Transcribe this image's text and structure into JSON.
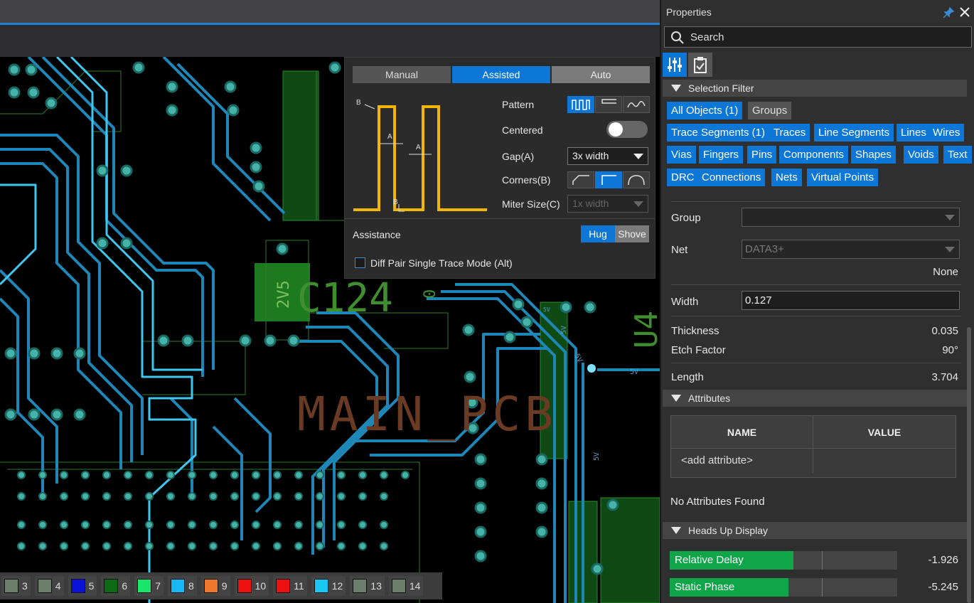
{
  "layers": [
    {
      "num": "3",
      "color": "#6b7f6b"
    },
    {
      "num": "4",
      "color": "#6b7f6b"
    },
    {
      "num": "5",
      "color": "#0a14d8"
    },
    {
      "num": "6",
      "color": "#0c6a12"
    },
    {
      "num": "7",
      "color": "#19e66a"
    },
    {
      "num": "8",
      "color": "#18b8f2"
    },
    {
      "num": "9",
      "color": "#f0782a"
    },
    {
      "num": "10",
      "color": "#ee1111"
    },
    {
      "num": "11",
      "color": "#ee1111"
    },
    {
      "num": "12",
      "color": "#18c8f2"
    },
    {
      "num": "13",
      "color": "#6b7f6b"
    },
    {
      "num": "14",
      "color": "#6b7f6b"
    }
  ],
  "canvas": {
    "labels": [
      "2V5",
      "C124",
      "0",
      "MAIN_PCB",
      "U4",
      "5V",
      "5V",
      "5V",
      "5V",
      "5V"
    ]
  },
  "assist": {
    "modes": [
      "Manual",
      "Assisted",
      "Auto"
    ],
    "active_mode": "Assisted",
    "pattern_label": "Pattern",
    "centered_label": "Centered",
    "centered_on": false,
    "gap_label": "Gap(A)",
    "gap_value": "3x width",
    "corners_label": "Corners(B)",
    "miter_label": "Miter Size(C)",
    "miter_value": "1x width",
    "diagram_labels": {
      "a1": "A",
      "a2": "A",
      "b1": "B",
      "b2": "B"
    },
    "assistance_label": "Assistance",
    "hug_label": "Hug",
    "shove_label": "Shove",
    "diff_pair_label": "Diff Pair Single Trace Mode (Alt)",
    "diff_pair_checked": false
  },
  "properties": {
    "title": "Properties",
    "search_placeholder": "Search",
    "selection_filter_title": "Selection Filter",
    "filters": [
      {
        "label": "All Objects (1)",
        "active": true
      },
      {
        "label": "Groups",
        "active": false
      },
      {
        "label": "Trace Segments (1)",
        "active": true
      },
      {
        "label": "Traces",
        "active": true
      },
      {
        "label": "Line Segments",
        "active": true
      },
      {
        "label": "Lines",
        "active": true
      },
      {
        "label": "Wires",
        "active": true
      },
      {
        "label": "Vias",
        "active": true
      },
      {
        "label": "Fingers",
        "active": true
      },
      {
        "label": "Pins",
        "active": true
      },
      {
        "label": "Components",
        "active": true
      },
      {
        "label": "Shapes",
        "active": true
      },
      {
        "label": "Voids",
        "active": true
      },
      {
        "label": "Text",
        "active": true
      },
      {
        "label": "DRC",
        "active": true
      },
      {
        "label": "Connections",
        "active": true
      },
      {
        "label": "Nets",
        "active": true
      },
      {
        "label": "Virtual Points",
        "active": true
      }
    ],
    "group_label": "Group",
    "group_value": "",
    "net_label": "Net",
    "net_value": "DATA3+",
    "net_class": "None",
    "width_label": "Width",
    "width_value": "0.127",
    "thickness_label": "Thickness",
    "thickness_value": "0.035",
    "etch_label": "Etch Factor",
    "etch_value": "90°",
    "length_label": "Length",
    "length_value": "3.704",
    "attributes_title": "Attributes",
    "attr_name_header": "NAME",
    "attr_value_header": "VALUE",
    "add_attribute": "<add attribute>",
    "no_attributes": "No Attributes Found",
    "hud_title": "Heads Up Display",
    "hud": [
      {
        "label": "Relative Delay",
        "value": "-1.926",
        "level": 0.31
      },
      {
        "label": "Static Phase",
        "value": "-5.245",
        "level": 0.28
      }
    ]
  },
  "colors": {
    "accent": "#0d77d8",
    "trace_cyan": "#3fc7f0",
    "trace_blue": "#1f86b8",
    "via": "#46b3a9",
    "silk_green": "#3f8f2f",
    "silk_brown": "#6b3a22",
    "hud_green": "#0fa64a"
  }
}
